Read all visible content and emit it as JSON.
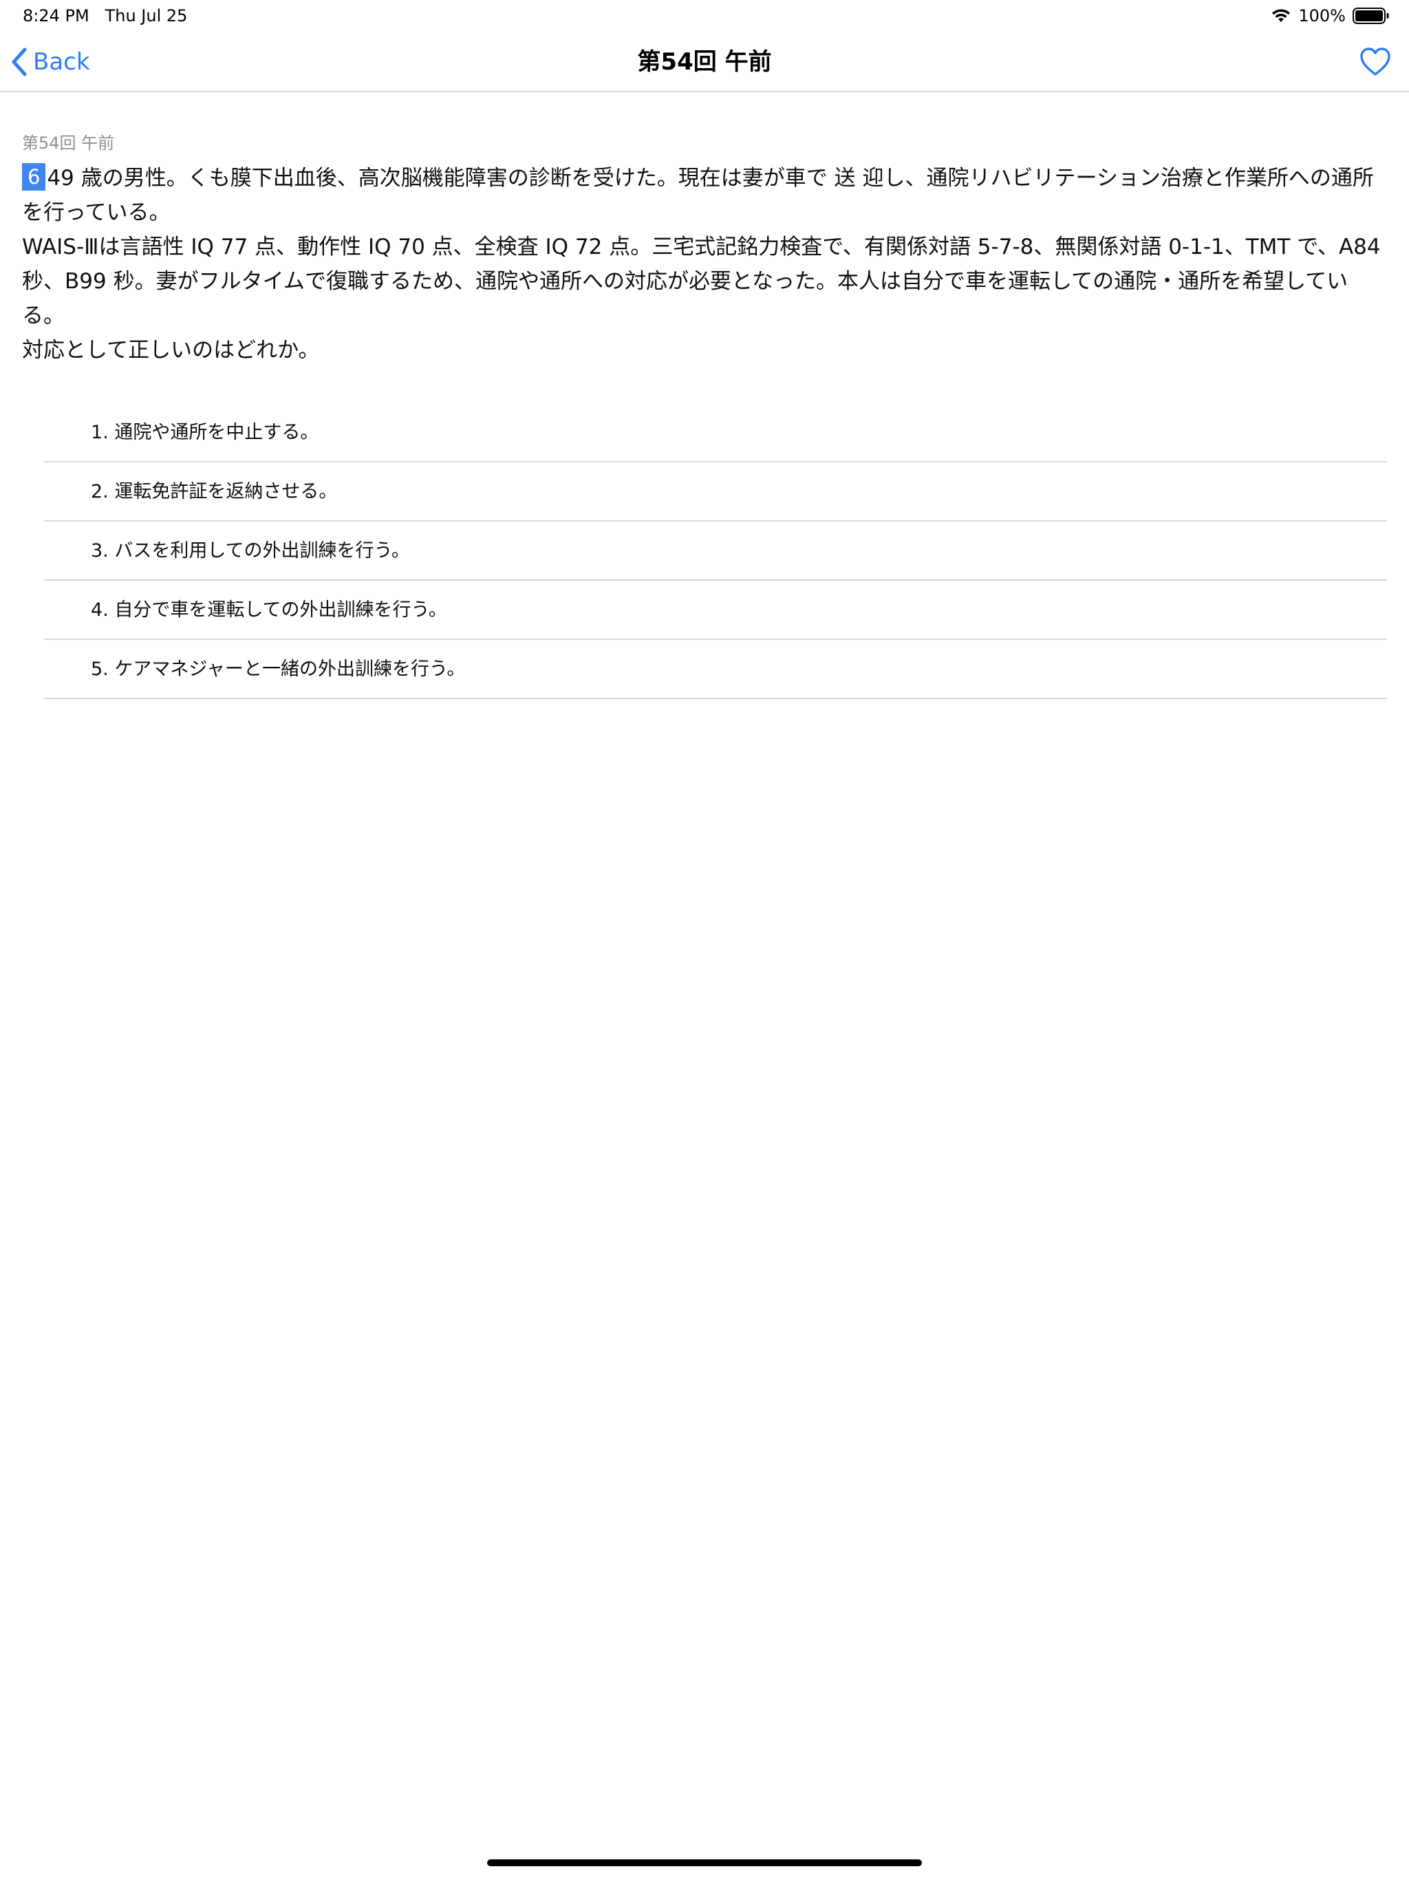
{
  "status_bar": {
    "time": "8:24 PM",
    "date": "Thu Jul 25",
    "battery_percent": "100%",
    "wifi_icon": "wifi-icon",
    "battery_icon": "battery-full-icon"
  },
  "nav": {
    "back_label": "Back",
    "title": "第54回 午前",
    "back_icon": "chevron-left-icon",
    "favorite_icon": "heart-outline-icon",
    "accent_color": "#2f7cf6"
  },
  "question": {
    "exam_label": "第54回 午前",
    "number": "6",
    "lines": [
      "49 歳の男性。くも膜下出血後、高次脳機能障害の診断を受けた。現在は妻が車で 送 迎し、通院リハビリテーション治療と作業所への通所を行っている。",
      "WAIS-Ⅲは言語性 IQ 77 点、動作性 IQ 70 点、全検査 IQ 72 点。三宅式記銘力検査で、有関係対語 5-7-8、無関係対語 0-1-1、TMT で、A84 秒、B99 秒。妻がフルタイムで復職するため、通院や通所への対応が必要となった。本人は自分で車を運転しての通院・通所を希望している。",
      "対応として正しいのはどれか。"
    ],
    "highlight_color": "#3f86ee"
  },
  "choices": [
    "1. 通院や通所を中止する。",
    "2. 運転免許証を返納させる。",
    "3. バスを利用しての外出訓練を行う。",
    "4. 自分で車を運転しての外出訓練を行う。",
    "5. ケアマネジャーと一緒の外出訓練を行う。"
  ]
}
